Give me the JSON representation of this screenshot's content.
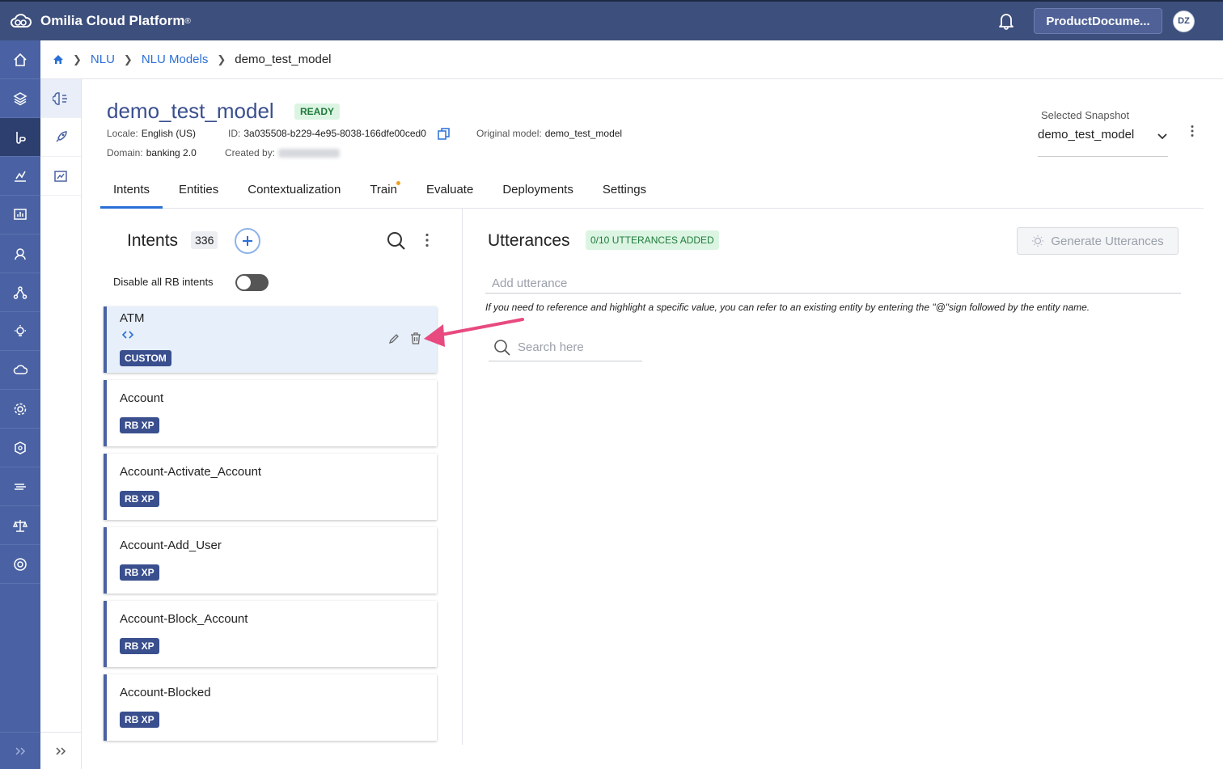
{
  "app": {
    "name": "Omilia Cloud Platform",
    "registered": "®"
  },
  "topbar": {
    "org_button": "ProductDocume...",
    "avatar_initials": "DZ"
  },
  "nav_rail": {
    "items": [
      "home-icon",
      "layers-icon",
      "nlu-icon",
      "insights-icon",
      "analytics-icon",
      "agent-icon",
      "flow-icon",
      "idea-icon",
      "cloud-icon",
      "settings-icon",
      "security-icon",
      "speech-icon",
      "balance-icon",
      "support-icon"
    ],
    "active_index": 2
  },
  "sub_rail": {
    "items": [
      "brain-icon",
      "rocket-icon",
      "report-icon"
    ],
    "active_index": 0
  },
  "breadcrumb": {
    "home": "home-icon",
    "items": [
      "NLU",
      "NLU Models"
    ],
    "current": "demo_test_model"
  },
  "model": {
    "title": "demo_test_model",
    "status": "READY",
    "locale_label": "Locale:",
    "locale_value": "English (US)",
    "id_label": "ID:",
    "id_value": "3a035508-b229-4e95-8038-166dfe00ced0",
    "original_label": "Original model:",
    "original_value": "demo_test_model",
    "domain_label": "Domain:",
    "domain_value": "banking 2.0",
    "created_label": "Created by:"
  },
  "snapshot": {
    "label": "Selected Snapshot",
    "value": "demo_test_model"
  },
  "tabs": [
    {
      "label": "Intents",
      "active": true
    },
    {
      "label": "Entities"
    },
    {
      "label": "Contextualization"
    },
    {
      "label": "Train",
      "dot": true
    },
    {
      "label": "Evaluate"
    },
    {
      "label": "Deployments"
    },
    {
      "label": "Settings"
    }
  ],
  "intents_panel": {
    "title": "Intents",
    "count": "336",
    "rb_toggle_label": "Disable all RB intents",
    "rb_toggle_on": false,
    "items": [
      {
        "name": "ATM",
        "badge": "CUSTOM",
        "selected": true
      },
      {
        "name": "Account",
        "badge": "RB XP"
      },
      {
        "name": "Account-Activate_Account",
        "badge": "RB XP"
      },
      {
        "name": "Account-Add_User",
        "badge": "RB XP"
      },
      {
        "name": "Account-Block_Account",
        "badge": "RB XP"
      },
      {
        "name": "Account-Blocked",
        "badge": "RB XP"
      }
    ]
  },
  "utterances_panel": {
    "title": "Utterances",
    "badge": "0/10 UTTERANCES ADDED",
    "generate_button": "Generate Utterances",
    "input_placeholder": "Add utterance",
    "hint": "If you need to reference and highlight a specific value, you can refer to an existing entity by entering the \"@\"sign followed by the entity name.",
    "search_placeholder": "Search here"
  },
  "colors": {
    "topbar": "#3d4f7c",
    "rail": "#4a62a3",
    "accent": "#2a6fd6",
    "title": "#3a4f8e",
    "arrow": "#e84a7f"
  }
}
